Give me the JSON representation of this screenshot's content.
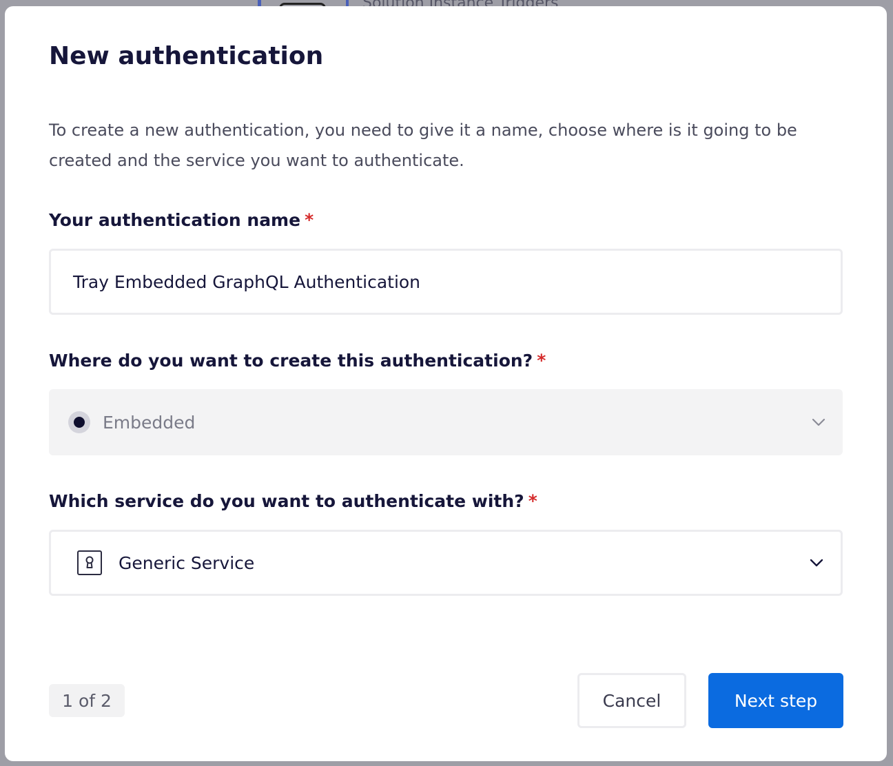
{
  "background": {
    "partial_text": "Solution Instance Triggers"
  },
  "modal": {
    "title": "New authentication",
    "description": "To create a new authentication, you need to give it a name, choose where is it going to be created and the service you want to authenticate.",
    "fields": {
      "name": {
        "label": "Your authentication name",
        "required_marker": "*",
        "value": "Tray Embedded GraphQL Authentication"
      },
      "location": {
        "label": "Where do you want to create this authentication?",
        "required_marker": "*",
        "value": "Embedded",
        "icon": "radio-dot-icon",
        "disabled": true
      },
      "service": {
        "label": "Which service do you want to authenticate with?",
        "required_marker": "*",
        "value": "Generic Service",
        "icon": "keyhole-icon"
      }
    },
    "footer": {
      "step": "1 of 2",
      "cancel_label": "Cancel",
      "next_label": "Next step"
    }
  },
  "colors": {
    "primary": "#0b6be0",
    "required": "#d52b2b",
    "overlay": "#9e9ea6",
    "text": "#16163a"
  }
}
